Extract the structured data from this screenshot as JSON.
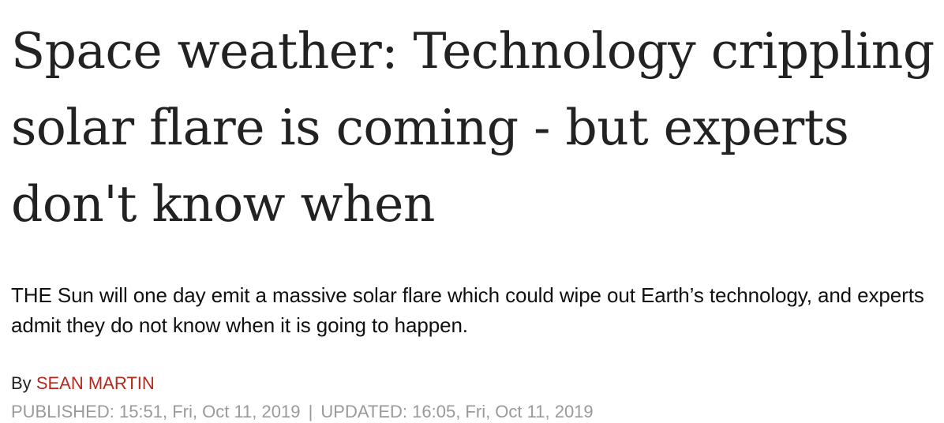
{
  "article": {
    "headline": "Space weather: Technology crippling solar flare is coming - but experts don't know when",
    "standfirst": "THE Sun will one day emit a massive solar flare which could wipe out Earth’s technology, and experts admit they do not know when it is going to happen.",
    "byline_prefix": "By",
    "author": "SEAN MARTIN",
    "published_label": "PUBLISHED:",
    "published_value": "15:51, Fri, Oct 11, 2019",
    "separator": "|",
    "updated_label": "UPDATED:",
    "updated_value": "16:05, Fri, Oct 11, 2019"
  },
  "colors": {
    "author_link": "#b8281d",
    "dates_text": "#9a9a9a",
    "headline_text": "#222222"
  }
}
